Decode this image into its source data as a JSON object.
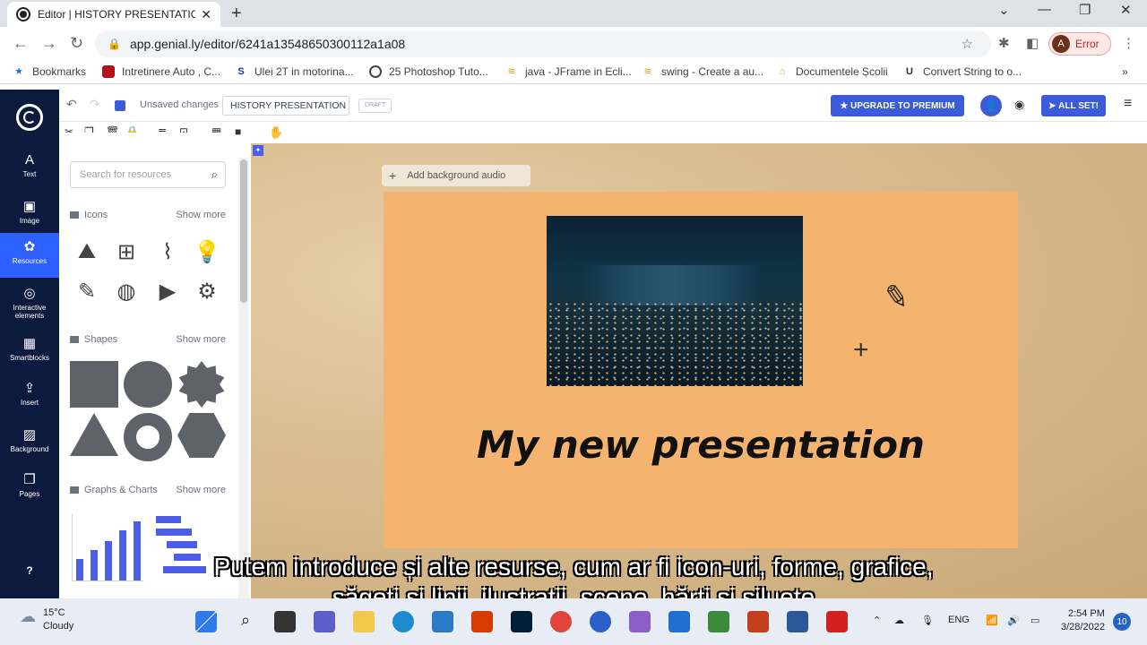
{
  "browser": {
    "tab_title": "Editor | HISTORY PRESENTATION",
    "url": "app.genial.ly/editor/6241a13548650300112a1a08",
    "profile_label": "Error",
    "profile_initial": "A",
    "bookmarks": [
      {
        "label": "Bookmarks"
      },
      {
        "label": "Intretinere Auto , C..."
      },
      {
        "label": "Ulei 2T in motorina..."
      },
      {
        "label": "25 Photoshop Tuto..."
      },
      {
        "label": "java - JFrame in Ecli..."
      },
      {
        "label": "swing - Create a au..."
      },
      {
        "label": "Documentele Școlii"
      },
      {
        "label": "Convert String to o..."
      }
    ]
  },
  "leftnav": {
    "items": [
      {
        "label": "Text",
        "icon": "A"
      },
      {
        "label": "Image",
        "icon": "▣"
      },
      {
        "label": "Resources",
        "icon": "✿"
      },
      {
        "label": "Interactive elements",
        "icon": "◎"
      },
      {
        "label": "Smartblocks",
        "icon": "▦"
      },
      {
        "label": "Insert",
        "icon": "⇪"
      },
      {
        "label": "Background",
        "icon": "▨"
      },
      {
        "label": "Pages",
        "icon": "❐"
      }
    ],
    "help": "?"
  },
  "topbar": {
    "unsaved": "Unsaved changes",
    "doc_title": "HISTORY PRESENTATION I",
    "draft": "DRAFT",
    "premium": "UPGRADE TO PREMIUM",
    "all_set": "ALL SET!"
  },
  "resources": {
    "search_placeholder": "Search for resources",
    "icons_title": "Icons",
    "shapes_title": "Shapes",
    "charts_title": "Graphs & Charts",
    "show_more": "Show more"
  },
  "canvas": {
    "audio_label": "Add background audio",
    "slide_title": "My new presentation"
  },
  "subtitle": {
    "line1": "Putem introduce și alte resurse, cum ar fi icon-uri, forme, grafice,",
    "line2": "săgeți și linii, ilustrații, scene, hărți și siluete"
  },
  "taskbar": {
    "temp": "15°C",
    "weather": "Cloudy",
    "lang": "ENG",
    "time": "2:54 PM",
    "date": "3/28/2022",
    "notifications": "10"
  }
}
